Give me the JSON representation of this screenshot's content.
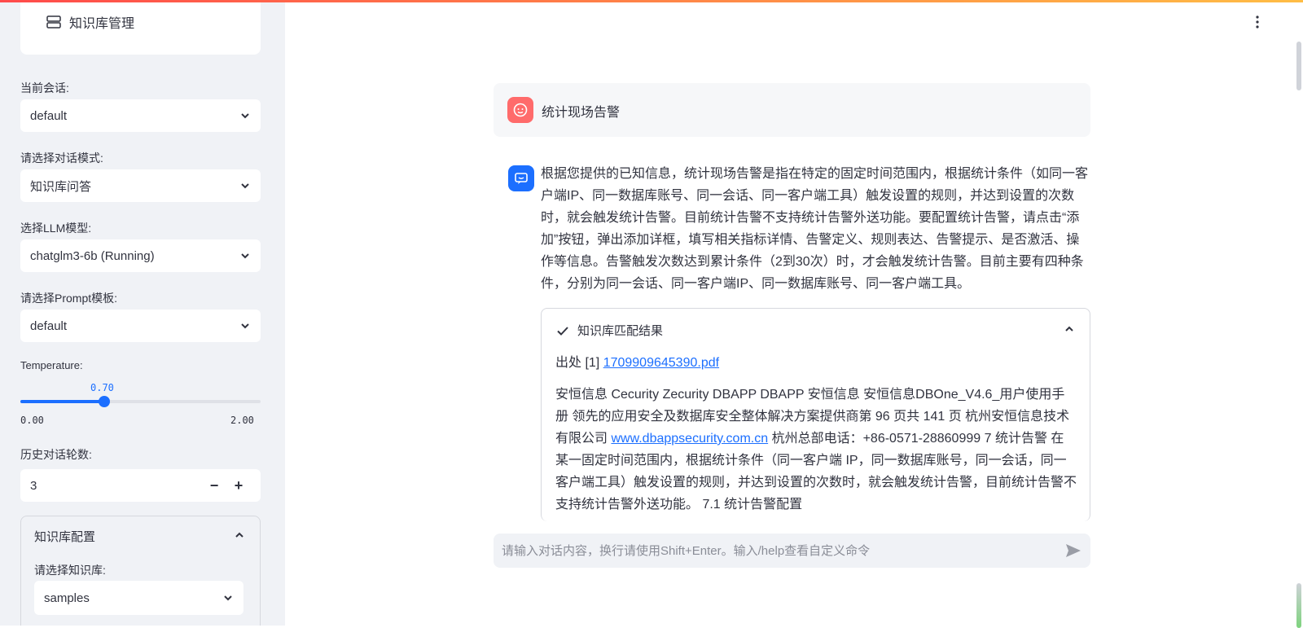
{
  "sidebar": {
    "nav_label": "知识库管理",
    "session_label": "当前会话:",
    "session_value": "default",
    "mode_label": "请选择对话模式:",
    "mode_value": "知识库问答",
    "llm_label": "选择LLM模型:",
    "llm_value": "chatglm3-6b (Running)",
    "prompt_label": "请选择Prompt模板:",
    "prompt_value": "default",
    "temperature": {
      "label": "Temperature:",
      "value": "0.70",
      "min": "0.00",
      "max": "2.00",
      "fraction": 0.35
    },
    "history_label": "历史对话轮数:",
    "history_value": "3",
    "minus": "−",
    "plus": "+",
    "kb_config": {
      "title": "知识库配置",
      "select_label": "请选择知识库:",
      "select_value": "samples"
    }
  },
  "chat": {
    "user_message": "统计现场告警",
    "bot_message": "根据您提供的已知信息，统计现场告警是指在特定的固定时间范围内，根据统计条件（如同一客户端IP、同一数据库账号、同一会话、同一客户端工具）触发设置的规则，并达到设置的次数时，就会触发统计告警。目前统计告警不支持统计告警外送功能。要配置统计告警，请点击“添加”按钮，弹出添加详框，填写相关指标详情、告警定义、规则表达、告警提示、是否激活、操作等信息。告警触发次数达到累计条件（2到30次）时，才会触发统计告警。目前主要有四种条件，分别为同一会话、同一客户端IP、同一数据库账号、同一客户端工具。",
    "result": {
      "title": "知识库匹配结果",
      "source_prefix": "出处 [1] ",
      "source_link": "1709909645390.pdf",
      "body_part1": "安恒信息 Cecurity Zecurity DBAPP DBAPP 安恒信息 安恒信息DBOne_V4.6_用户使用手册 领先的应用安全及数据库安全整体解决方案提供商第 96 页共 141 页 杭州安恒信息技术有限公司 ",
      "body_link": "www.dbappsecurity.com.cn",
      "body_part2": " 杭州总部电话：+86-0571-28860999 7 统计告警 在某一固定时间范围内，根据统计条件（同一客户端 IP，同一数据库账号，同一会话，同一客户端工具）触发设置的规则，并达到设置的次数时，就会触发统计告警，目前统计告警不支持统计告警外送功能。 7.1 统计告警配置"
    },
    "input_placeholder": "请输入对话内容，换行请使用Shift+Enter。输入/help查看自定义命令"
  },
  "colors": {
    "accent": "#1c6fff",
    "user_avatar": "#ff6b6b",
    "sidebar_bg": "#f0f2f6"
  },
  "icons": {
    "nav": "database-icon",
    "dropdown": "chevron-down-icon",
    "collapse": "chevron-up-icon",
    "check": "check-icon",
    "send": "send-icon",
    "menu": "kebab-menu-icon"
  }
}
